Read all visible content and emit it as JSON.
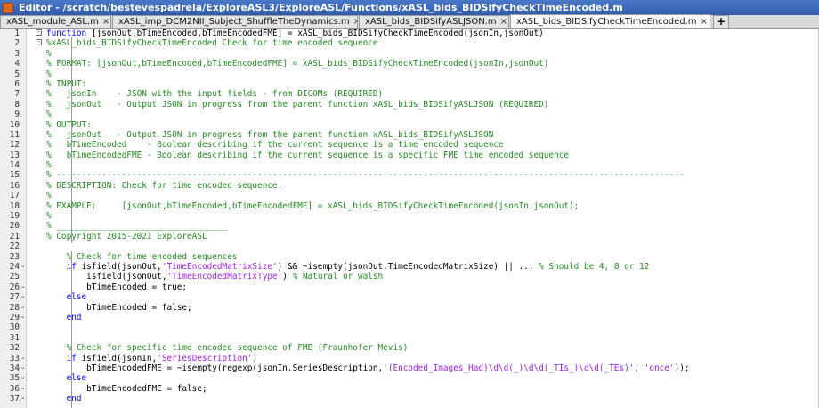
{
  "window": {
    "title": "Editor - /scratch/bestevespadrela/ExploreASL3/ExploreASL/Functions/xASL_bids_BIDSifyCheckTimeEncoded.m"
  },
  "tabs": [
    {
      "label": "xASL_module_ASL.m",
      "close": "×"
    },
    {
      "label": "xASL_imp_DCM2NII_Subject_ShuffleTheDynamics.m",
      "close": "×"
    },
    {
      "label": "xASL_bids_BIDSifyASLJSON.m",
      "close": "×"
    },
    {
      "label": "xASL_bids_BIDSifyCheckTimeEncoded.m",
      "close": "×"
    }
  ],
  "add_tab_label": "+",
  "lines": [
    {
      "n": "1",
      "m": "",
      "segs": [
        [
          "kw",
          "function "
        ],
        [
          "",
          "[jsonOut,bTimeEncoded,bTimeEncodedFME] = xASL_bids_BIDSifyCheckTimeEncoded(jsonIn,jsonOut)"
        ]
      ]
    },
    {
      "n": "2",
      "m": "",
      "segs": [
        [
          "cm",
          "%xASL_bids_BIDSifyCheckTimeEncoded Check for time encoded sequence"
        ]
      ]
    },
    {
      "n": "3",
      "m": "",
      "segs": [
        [
          "cm",
          "%"
        ]
      ]
    },
    {
      "n": "4",
      "m": "",
      "segs": [
        [
          "cm",
          "% FORMAT: [jsonOut,bTimeEncoded,bTimeEncodedFME] = xASL_bids_BIDSifyCheckTimeEncoded(jsonIn,jsonOut)"
        ]
      ]
    },
    {
      "n": "5",
      "m": "",
      "segs": [
        [
          "cm",
          "%"
        ]
      ]
    },
    {
      "n": "6",
      "m": "",
      "segs": [
        [
          "cm",
          "% INPUT:"
        ]
      ]
    },
    {
      "n": "7",
      "m": "",
      "segs": [
        [
          "cm",
          "%   jsonIn    - JSON with the input fields - from DICOMs (REQUIRED)"
        ]
      ]
    },
    {
      "n": "8",
      "m": "",
      "segs": [
        [
          "cm",
          "%   jsonOut   - Output JSON in progress from the parent function xASL_bids_BIDSifyASLJSON (REQUIRED)"
        ]
      ]
    },
    {
      "n": "9",
      "m": "",
      "segs": [
        [
          "cm",
          "%"
        ]
      ]
    },
    {
      "n": "10",
      "m": "",
      "segs": [
        [
          "cm",
          "% OUTPUT:"
        ]
      ]
    },
    {
      "n": "11",
      "m": "",
      "segs": [
        [
          "cm",
          "%   jsonOut   - Output JSON in progress from the parent function xASL_bids_BIDSifyASLJSON"
        ]
      ]
    },
    {
      "n": "12",
      "m": "",
      "segs": [
        [
          "cm",
          "%   bTimeEncoded    - Boolean describing if the current sequence is a time encoded sequence"
        ]
      ]
    },
    {
      "n": "13",
      "m": "",
      "segs": [
        [
          "cm",
          "%   bTimeEncodedFME - Boolean describing if the current sequence is a specific FME time encoded sequence"
        ]
      ]
    },
    {
      "n": "14",
      "m": "",
      "segs": [
        [
          "cm",
          "%"
        ]
      ]
    },
    {
      "n": "15",
      "m": "",
      "segs": [
        [
          "cm",
          "% -----------------------------------------------------------------------------------------------------------------------------"
        ]
      ]
    },
    {
      "n": "16",
      "m": "",
      "segs": [
        [
          "cm",
          "% DESCRIPTION: Check for time encoded sequence."
        ]
      ]
    },
    {
      "n": "17",
      "m": "",
      "segs": [
        [
          "cm",
          "%"
        ]
      ]
    },
    {
      "n": "18",
      "m": "",
      "segs": [
        [
          "cm",
          "% EXAMPLE:     [jsonOut,bTimeEncoded,bTimeEncodedFME] = xASL_bids_BIDSifyCheckTimeEncoded(jsonIn,jsonOut);"
        ]
      ]
    },
    {
      "n": "19",
      "m": "",
      "segs": [
        [
          "cm",
          "%"
        ]
      ]
    },
    {
      "n": "20",
      "m": "",
      "segs": [
        [
          "cm",
          "% __________________________________"
        ]
      ]
    },
    {
      "n": "21",
      "m": "",
      "segs": [
        [
          "cm",
          "% Copyright 2015-2021 ExploreASL"
        ]
      ]
    },
    {
      "n": "22",
      "m": "",
      "segs": [
        [
          "",
          ""
        ]
      ]
    },
    {
      "n": "23",
      "m": "",
      "segs": [
        [
          "cm",
          "    % Check for time encoded sequences"
        ]
      ]
    },
    {
      "n": "24",
      "m": "-",
      "segs": [
        [
          "kw",
          "    if "
        ],
        [
          "",
          "isfield(jsonOut,"
        ],
        [
          "st",
          "'TimeEncodedMatrixSize'"
        ],
        [
          "",
          ") && ~isempty(jsonOut.TimeEncodedMatrixSize) || ... "
        ],
        [
          "cm",
          "% Should be 4, 8 or 12"
        ]
      ]
    },
    {
      "n": "25",
      "m": "",
      "segs": [
        [
          "",
          "        isfield(jsonOut,"
        ],
        [
          "st",
          "'TimeEncodedMatrixType'"
        ],
        [
          "",
          ") "
        ],
        [
          "cm",
          "% Natural or walsh"
        ]
      ]
    },
    {
      "n": "26",
      "m": "-",
      "segs": [
        [
          "",
          "        bTimeEncoded = true;"
        ]
      ]
    },
    {
      "n": "27",
      "m": "-",
      "segs": [
        [
          "kw",
          "    else"
        ]
      ]
    },
    {
      "n": "28",
      "m": "-",
      "segs": [
        [
          "",
          "        bTimeEncoded = false;"
        ]
      ]
    },
    {
      "n": "29",
      "m": "-",
      "segs": [
        [
          "kw",
          "    end"
        ]
      ]
    },
    {
      "n": "30",
      "m": "",
      "segs": [
        [
          "",
          ""
        ]
      ]
    },
    {
      "n": "31",
      "m": "",
      "segs": [
        [
          "",
          ""
        ]
      ]
    },
    {
      "n": "32",
      "m": "",
      "segs": [
        [
          "cm",
          "    % Check for specific time encoded sequence of FME (Fraunhofer Mevis)"
        ]
      ]
    },
    {
      "n": "33",
      "m": "-",
      "segs": [
        [
          "kw",
          "    if "
        ],
        [
          "",
          "isfield(jsonIn,"
        ],
        [
          "st",
          "'SeriesDescription'"
        ],
        [
          "",
          ")"
        ]
      ]
    },
    {
      "n": "34",
      "m": "-",
      "segs": [
        [
          "",
          "        bTimeEncodedFME = ~isempty(regexp(jsonIn.SeriesDescription,"
        ],
        [
          "st",
          "'(Encoded_Images_Had)\\d\\d(_)\\d\\d(_TIs_)\\d\\d(_TEs)'"
        ],
        [
          "",
          ", "
        ],
        [
          "st",
          "'once'"
        ],
        [
          "",
          "));"
        ]
      ]
    },
    {
      "n": "35",
      "m": "-",
      "segs": [
        [
          "kw",
          "    else"
        ]
      ]
    },
    {
      "n": "36",
      "m": "-",
      "segs": [
        [
          "",
          "        bTimeEncodedFME = false;"
        ]
      ]
    },
    {
      "n": "37",
      "m": "-",
      "segs": [
        [
          "kw",
          "    end"
        ]
      ]
    }
  ]
}
